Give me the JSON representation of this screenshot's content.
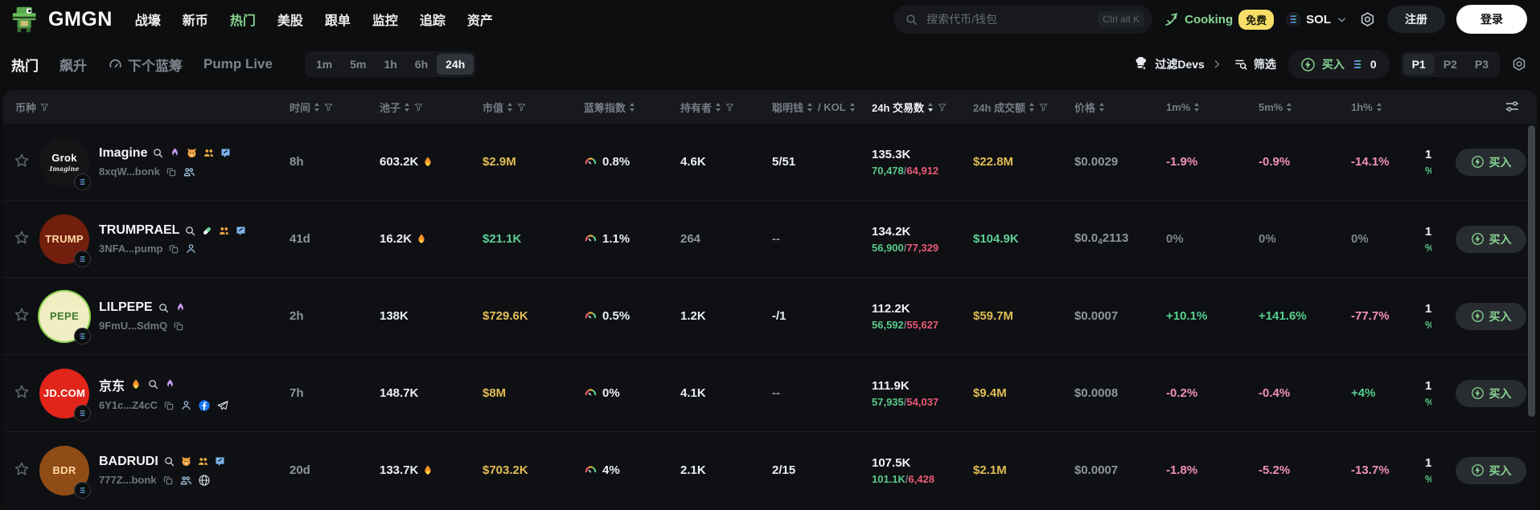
{
  "topnav": {
    "brand": "GMGN",
    "menu": [
      {
        "label": "战壕",
        "active": false
      },
      {
        "label": "新币",
        "active": false
      },
      {
        "label": "热门",
        "active": true
      },
      {
        "label": "美股",
        "active": false
      },
      {
        "label": "跟单",
        "active": false
      },
      {
        "label": "监控",
        "active": false
      },
      {
        "label": "追踪",
        "active": false
      },
      {
        "label": "资产",
        "active": false
      }
    ],
    "search": {
      "placeholder": "搜索代币/钱包",
      "shortcut": "Ctrl alt K"
    },
    "cooking_label": "Cooking",
    "cooking_badge": "免费",
    "chain": "SOL",
    "register_label": "注册",
    "login_label": "登录"
  },
  "subnav": {
    "tabs": [
      {
        "label": "热门",
        "active": true,
        "icon": ""
      },
      {
        "label": "飙升",
        "active": false,
        "icon": ""
      },
      {
        "label": "下个蓝筹",
        "active": false,
        "icon": "speedometer"
      },
      {
        "label": "Pump Live",
        "active": false,
        "icon": ""
      }
    ],
    "time_filters": [
      "1m",
      "5m",
      "1h",
      "6h",
      "24h"
    ],
    "active_time": "24h",
    "filter_devs_label": "过滤Devs",
    "filter_label": "筛选",
    "buy_label": "买入",
    "buy_amount": "0",
    "presets": [
      "P1",
      "P2",
      "P3"
    ],
    "active_preset": "P1"
  },
  "colors": {
    "accent_green": "#88d693",
    "positive": "#56cf8f",
    "negative": "#f290b5",
    "buy_count": "#5cc98b",
    "sell_count": "#ea5976",
    "value_yellow": "#e2bd54",
    "value_green": "#5fcf96",
    "badge_yellow": "#f5dd68"
  },
  "table": {
    "columns": [
      {
        "label": "币种",
        "sort": false,
        "funnel": true,
        "active": false
      },
      {
        "label": "时间",
        "sort": true,
        "funnel": true,
        "active": false
      },
      {
        "label": "池子",
        "sort": true,
        "funnel": true,
        "active": false
      },
      {
        "label": "市值",
        "sort": true,
        "funnel": true,
        "active": false
      },
      {
        "label": "蓝筹指数",
        "sort": true,
        "funnel": false,
        "active": false
      },
      {
        "label": "持有者",
        "sort": true,
        "funnel": true,
        "active": false
      },
      {
        "label": "聪明钱",
        "sort": true,
        "funnel": false,
        "active": false,
        "extra": "/ KOL",
        "extra_sort": true
      },
      {
        "label": "24h 交易数",
        "sort": true,
        "funnel": true,
        "active": true
      },
      {
        "label": "24h 成交额",
        "sort": true,
        "funnel": true,
        "active": false
      },
      {
        "label": "价格",
        "sort": true,
        "funnel": false,
        "active": false
      },
      {
        "label": "1m%",
        "sort": true,
        "funnel": false,
        "active": false
      },
      {
        "label": "5m%",
        "sort": true,
        "funnel": false,
        "active": false
      },
      {
        "label": "1h%",
        "sort": true,
        "funnel": false,
        "active": false
      }
    ],
    "rows": [
      {
        "symbol": "Imagine",
        "avatar": {
          "text": "Grok",
          "subtext": "Imagine",
          "bg": "#151518",
          "fg": "#ffffff",
          "ring": ""
        },
        "name_icons": [
          "search",
          "flame-purple",
          "bonk",
          "people-orange",
          "chat-badge"
        ],
        "address": "8xqW...bonk",
        "address_icons": [
          "copy",
          "people-blue"
        ],
        "age": "8h",
        "pool": {
          "value": "603.2K",
          "fire": true
        },
        "market_cap": {
          "value": "$2.9M",
          "tone": "yellow"
        },
        "bluechip": "0.8%",
        "holders": {
          "value": "4.6K",
          "tone": "white"
        },
        "smart_kol": {
          "value": "5/51",
          "tone": "white"
        },
        "txs": {
          "total": "135.3K",
          "buys": "70,478",
          "sells": "64,912"
        },
        "volume": {
          "value": "$22.8M",
          "tone": "yellow"
        },
        "price": {
          "pre": "$0.0029",
          "sub": "",
          "post": ""
        },
        "chg_1m": {
          "value": "-1.9%",
          "tone": "down"
        },
        "chg_5m": {
          "value": "-0.9%",
          "tone": "down"
        },
        "chg_1h": {
          "value": "-14.1%",
          "tone": "down"
        },
        "clipped": {
          "top": "1",
          "bottom": "%"
        },
        "buy_label": "买入"
      },
      {
        "symbol": "TRUMPRAEL",
        "avatar": {
          "text": "TRUMP",
          "subtext": "",
          "bg": "#731f0d",
          "fg": "#ffd9a6",
          "ring": ""
        },
        "name_icons": [
          "search",
          "pill",
          "people-orange",
          "chat-badge"
        ],
        "address": "3NFA...pump",
        "address_icons": [
          "copy",
          "person"
        ],
        "age": "41d",
        "pool": {
          "value": "16.2K",
          "fire": true
        },
        "market_cap": {
          "value": "$21.1K",
          "tone": "green"
        },
        "bluechip": "1.1%",
        "holders": {
          "value": "264",
          "tone": "gray"
        },
        "smart_kol": {
          "value": "--",
          "tone": "gray"
        },
        "txs": {
          "total": "134.2K",
          "buys": "56,900",
          "sells": "77,329"
        },
        "volume": {
          "value": "$104.9K",
          "tone": "green"
        },
        "price": {
          "pre": "$0.0",
          "sub": "4",
          "post": "2113"
        },
        "chg_1m": {
          "value": "0%",
          "tone": "flat"
        },
        "chg_5m": {
          "value": "0%",
          "tone": "flat"
        },
        "chg_1h": {
          "value": "0%",
          "tone": "flat"
        },
        "clipped": {
          "top": "1",
          "bottom": "%"
        },
        "buy_label": "买入"
      },
      {
        "symbol": "LILPEPE",
        "avatar": {
          "text": "PEPE",
          "subtext": "",
          "bg": "#f0edc2",
          "fg": "#3f7a33",
          "ring": "#8fd14f"
        },
        "name_icons": [
          "search",
          "flame-purple"
        ],
        "address": "9FmU...SdmQ",
        "address_icons": [
          "copy"
        ],
        "age": "2h",
        "pool": {
          "value": "138K",
          "fire": false
        },
        "market_cap": {
          "value": "$729.6K",
          "tone": "yellow"
        },
        "bluechip": "0.5%",
        "holders": {
          "value": "1.2K",
          "tone": "white"
        },
        "smart_kol": {
          "value": "-/1",
          "tone": "white"
        },
        "txs": {
          "total": "112.2K",
          "buys": "56,592",
          "sells": "55,627"
        },
        "volume": {
          "value": "$59.7M",
          "tone": "yellow"
        },
        "price": {
          "pre": "$0.0007",
          "sub": "",
          "post": ""
        },
        "chg_1m": {
          "value": "+10.1%",
          "tone": "up"
        },
        "chg_5m": {
          "value": "+141.6%",
          "tone": "up"
        },
        "chg_1h": {
          "value": "-77.7%",
          "tone": "down"
        },
        "clipped": {
          "top": "1",
          "bottom": "%"
        },
        "buy_label": "买入"
      },
      {
        "symbol": "京东",
        "avatar": {
          "text": "JD.COM",
          "subtext": "",
          "bg": "#e1251b",
          "fg": "#ffffff",
          "ring": ""
        },
        "name_icons": [
          "fire-orange",
          "search",
          "flame-purple"
        ],
        "address": "6Y1c...Z4cC",
        "address_icons": [
          "copy",
          "person",
          "facebook",
          "telegram"
        ],
        "age": "7h",
        "pool": {
          "value": "148.7K",
          "fire": false
        },
        "market_cap": {
          "value": "$8M",
          "tone": "yellow"
        },
        "bluechip": "0%",
        "holders": {
          "value": "4.1K",
          "tone": "white"
        },
        "smart_kol": {
          "value": "--",
          "tone": "gray"
        },
        "txs": {
          "total": "111.9K",
          "buys": "57,935",
          "sells": "54,037"
        },
        "volume": {
          "value": "$9.4M",
          "tone": "yellow"
        },
        "price": {
          "pre": "$0.0008",
          "sub": "",
          "post": ""
        },
        "chg_1m": {
          "value": "-0.2%",
          "tone": "down"
        },
        "chg_5m": {
          "value": "-0.4%",
          "tone": "down"
        },
        "chg_1h": {
          "value": "+4%",
          "tone": "up"
        },
        "clipped": {
          "top": "1",
          "bottom": "%"
        },
        "buy_label": "买入"
      },
      {
        "symbol": "BADRUDI",
        "avatar": {
          "text": "BDR",
          "subtext": "",
          "bg": "#8f4c15",
          "fg": "#ffd9a6",
          "ring": ""
        },
        "name_icons": [
          "search",
          "bonk",
          "people-orange",
          "chat-badge"
        ],
        "address": "777Z...bonk",
        "address_icons": [
          "copy",
          "people-blue",
          "globe"
        ],
        "age": "20d",
        "pool": {
          "value": "133.7K",
          "fire": true
        },
        "market_cap": {
          "value": "$703.2K",
          "tone": "yellow"
        },
        "bluechip": "4%",
        "holders": {
          "value": "2.1K",
          "tone": "white"
        },
        "smart_kol": {
          "value": "2/15",
          "tone": "white"
        },
        "txs": {
          "total": "107.5K",
          "buys": "101.1K",
          "sells": "6,428"
        },
        "volume": {
          "value": "$2.1M",
          "tone": "yellow"
        },
        "price": {
          "pre": "$0.0007",
          "sub": "",
          "post": ""
        },
        "chg_1m": {
          "value": "-1.8%",
          "tone": "down"
        },
        "chg_5m": {
          "value": "-5.2%",
          "tone": "down"
        },
        "chg_1h": {
          "value": "-13.7%",
          "tone": "down"
        },
        "clipped": {
          "top": "1",
          "bottom": "%"
        },
        "buy_label": "买入"
      }
    ]
  }
}
